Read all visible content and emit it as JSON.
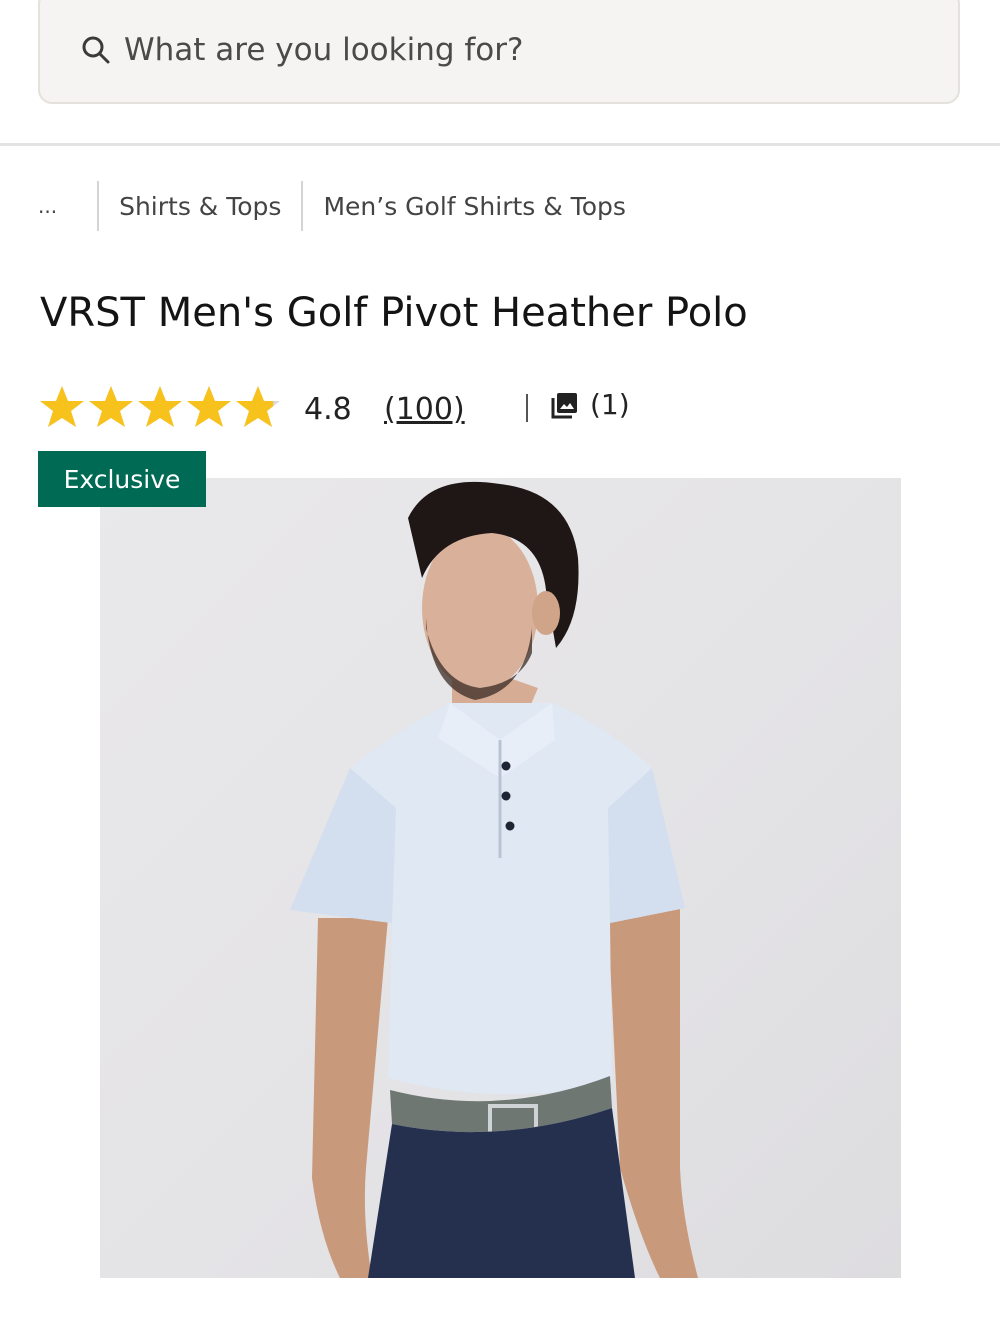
{
  "search": {
    "placeholder": "What are you looking for?"
  },
  "breadcrumb": {
    "ellipsis": "...",
    "items": [
      "Shirts & Tops",
      "Men’s Golf Shirts & Tops"
    ]
  },
  "product": {
    "title": "VRST Men's Golf Pivot Heather Polo",
    "rating": {
      "value": "4.8",
      "value_number": 4.8,
      "max": 5,
      "count": "(100)",
      "photos_count": "(1)"
    },
    "badge": "Exclusive"
  },
  "colors": {
    "accent_green": "#006a54",
    "star_gold": "#f7c21b"
  }
}
